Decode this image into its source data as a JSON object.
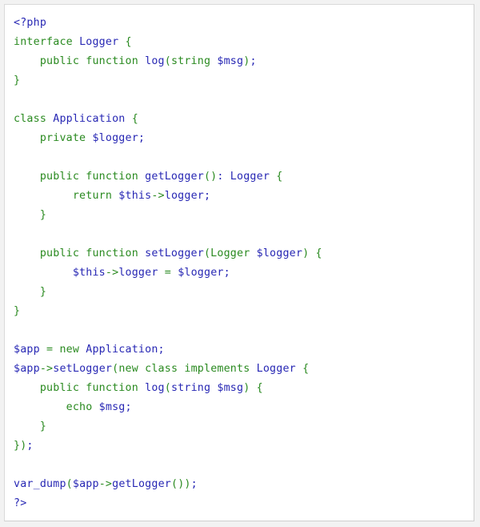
{
  "language": "php",
  "colors": {
    "identifier": "#2828b4",
    "keyword": "#2a8a20",
    "background": "#ffffff",
    "page": "#f2f2f2",
    "border": "#d9d9d9"
  },
  "lines": [
    [
      [
        "b",
        "<?php"
      ]
    ],
    [
      [
        "g",
        "interface "
      ],
      [
        "b",
        "Logger "
      ],
      [
        "g",
        "{"
      ]
    ],
    [
      [
        "g",
        "    public function "
      ],
      [
        "b",
        "log"
      ],
      [
        "g",
        "(string "
      ],
      [
        "b",
        "$msg"
      ],
      [
        "g",
        ")"
      ],
      [
        "b",
        ";"
      ]
    ],
    [
      [
        "g",
        "}"
      ]
    ],
    [],
    [
      [
        "g",
        "class "
      ],
      [
        "b",
        "Application "
      ],
      [
        "g",
        "{"
      ]
    ],
    [
      [
        "g",
        "    private "
      ],
      [
        "b",
        "$logger;"
      ]
    ],
    [],
    [
      [
        "g",
        "    public function "
      ],
      [
        "b",
        "getLogger"
      ],
      [
        "g",
        "()"
      ],
      [
        "b",
        ": Logger "
      ],
      [
        "g",
        "{"
      ]
    ],
    [
      [
        "g",
        "         return "
      ],
      [
        "b",
        "$this"
      ],
      [
        "g",
        "->"
      ],
      [
        "b",
        "logger;"
      ]
    ],
    [
      [
        "g",
        "    }"
      ]
    ],
    [],
    [
      [
        "g",
        "    public function "
      ],
      [
        "b",
        "setLogger"
      ],
      [
        "g",
        "(Logger "
      ],
      [
        "b",
        "$logger"
      ],
      [
        "g",
        ") {"
      ]
    ],
    [
      [
        "b",
        "         $this"
      ],
      [
        "g",
        "->"
      ],
      [
        "b",
        "logger "
      ],
      [
        "g",
        "= "
      ],
      [
        "b",
        "$logger;"
      ]
    ],
    [
      [
        "g",
        "    }"
      ]
    ],
    [
      [
        "g",
        "}"
      ]
    ],
    [],
    [
      [
        "b",
        "$app "
      ],
      [
        "g",
        "= new "
      ],
      [
        "b",
        "Application;"
      ]
    ],
    [
      [
        "b",
        "$app"
      ],
      [
        "g",
        "->"
      ],
      [
        "b",
        "setLogger"
      ],
      [
        "g",
        "(new class implements "
      ],
      [
        "b",
        "Logger "
      ],
      [
        "g",
        "{"
      ]
    ],
    [
      [
        "g",
        "    public function "
      ],
      [
        "b",
        "log"
      ],
      [
        "g",
        "("
      ],
      [
        "b",
        "string $msg"
      ],
      [
        "g",
        ") {"
      ]
    ],
    [
      [
        "g",
        "        echo "
      ],
      [
        "b",
        "$msg;"
      ]
    ],
    [
      [
        "g",
        "    }"
      ]
    ],
    [
      [
        "g",
        "})"
      ],
      [
        "b",
        ";"
      ]
    ],
    [],
    [
      [
        "b",
        "var_dump"
      ],
      [
        "g",
        "("
      ],
      [
        "b",
        "$app"
      ],
      [
        "g",
        "->"
      ],
      [
        "b",
        "getLogger"
      ],
      [
        "g",
        "())"
      ],
      [
        "b",
        ";"
      ]
    ],
    [
      [
        "b",
        "?>"
      ]
    ]
  ]
}
